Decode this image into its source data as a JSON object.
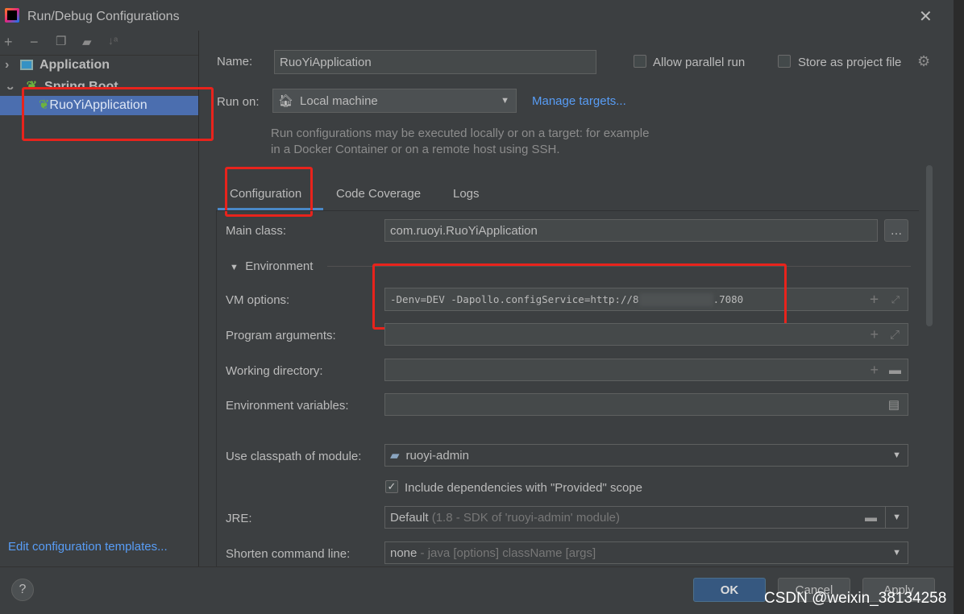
{
  "title": "Run/Debug Configurations",
  "tree": {
    "items": [
      {
        "label": "Application"
      },
      {
        "label": "Spring Boot"
      },
      {
        "label": "RuoYiApplication"
      }
    ]
  },
  "edit_templates": "Edit configuration templates...",
  "name_label": "Name:",
  "name_value": "RuoYiApplication",
  "allow_parallel": "Allow parallel run",
  "store_project": "Store as project file",
  "run_on_label": "Run on:",
  "run_on_value": "Local machine",
  "manage_targets": "Manage targets...",
  "run_hint": "Run configurations may be executed locally or on a target: for example in a Docker Container or on a remote host using SSH.",
  "tabs": [
    "Configuration",
    "Code Coverage",
    "Logs"
  ],
  "main_class_label": "Main class:",
  "main_class_value": "com.ruoyi.RuoYiApplication",
  "environment": "Environment",
  "vm_label": "VM options:",
  "vm_value": "-Denv=DEV -Dapollo.configService=http://8",
  "vm_value_end": ".7080",
  "program_args_label": "Program arguments:",
  "working_dir_label": "Working directory:",
  "env_vars_label": "Environment variables:",
  "classpath_label": "Use classpath of module:",
  "classpath_value": "ruoyi-admin",
  "include_deps": "Include dependencies with \"Provided\" scope",
  "include_deps_checked": true,
  "jre_label": "JRE:",
  "jre_value": "Default",
  "jre_hint": "(1.8 - SDK of 'ruoyi-admin' module)",
  "shorten_label": "Shorten command line:",
  "shorten_value": "none",
  "shorten_hint": "- java [options] className [args]",
  "ok": "OK",
  "cancel": "Cancel",
  "apply": "Apply",
  "watermark": "CSDN @weixin_38134258",
  "colors": {
    "accent": "#4b6eaf",
    "highlight": "#e8231c",
    "link": "#589df6"
  }
}
